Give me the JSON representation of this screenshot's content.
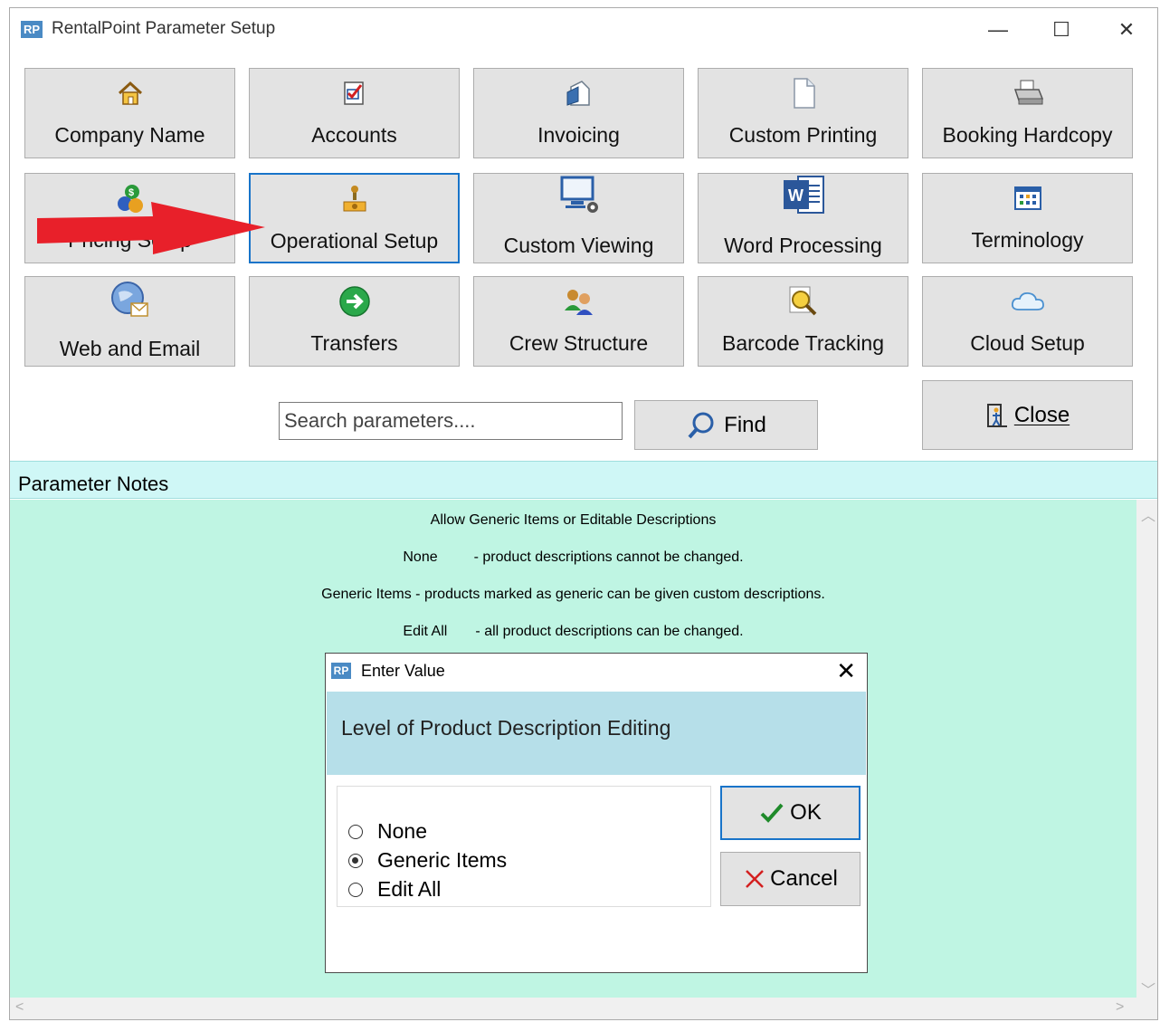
{
  "window": {
    "app_icon_text": "RP",
    "title": "RentalPoint Parameter Setup",
    "minimize": "—",
    "maximize": "☐",
    "close": "✕"
  },
  "tiles": [
    {
      "label": "Company Name",
      "icon": "house-icon"
    },
    {
      "label": "Accounts",
      "icon": "checklist-icon"
    },
    {
      "label": "Invoicing",
      "icon": "document-icon"
    },
    {
      "label": "Custom Printing",
      "icon": "blank-page-icon"
    },
    {
      "label": "Booking Hardcopy",
      "icon": "printer-icon"
    },
    {
      "label": "Pricing Setup",
      "icon": "currency-coins-icon"
    },
    {
      "label": "Operational Setup",
      "icon": "joystick-icon"
    },
    {
      "label": "Custom Viewing",
      "icon": "monitor-gear-icon"
    },
    {
      "label": "Word Processing",
      "icon": "word-icon"
    },
    {
      "label": "Terminology",
      "icon": "grid-icon"
    },
    {
      "label": "Web and Email",
      "icon": "globe-mail-icon"
    },
    {
      "label": "Transfers",
      "icon": "green-arrow-icon"
    },
    {
      "label": "Crew Structure",
      "icon": "people-icon"
    },
    {
      "label": "Barcode Tracking",
      "icon": "magnifier-icon"
    },
    {
      "label": "Cloud Setup",
      "icon": "cloud-icon"
    }
  ],
  "search": {
    "placeholder": "Search parameters...."
  },
  "find_button": {
    "label": "Find"
  },
  "close_button": {
    "label": "Close"
  },
  "notes": {
    "header": "Parameter Notes",
    "lines": [
      "Allow Generic Items or Editable Descriptions",
      "None         - product descriptions cannot be changed.",
      "Generic Items - products marked as generic can be given custom descriptions.",
      "Edit All       - all product descriptions can be changed."
    ]
  },
  "dialog": {
    "icon_text": "RP",
    "title": "Enter Value",
    "close": "✕",
    "prompt": "Level of Product Description Editing",
    "options": [
      {
        "label": "None",
        "checked": false
      },
      {
        "label": "Generic Items",
        "checked": true
      },
      {
        "label": "Edit All",
        "checked": false
      }
    ],
    "ok_label": "OK",
    "cancel_label": "Cancel"
  },
  "colors": {
    "tile_bg": "#e3e3e3",
    "selected_border": "#1874c9",
    "notes_header_bg": "#cff7f6",
    "notes_body_bg": "#bff5e3",
    "dialog_prompt_bg": "#b6dfe9",
    "annotation_arrow": "#e8202a"
  }
}
